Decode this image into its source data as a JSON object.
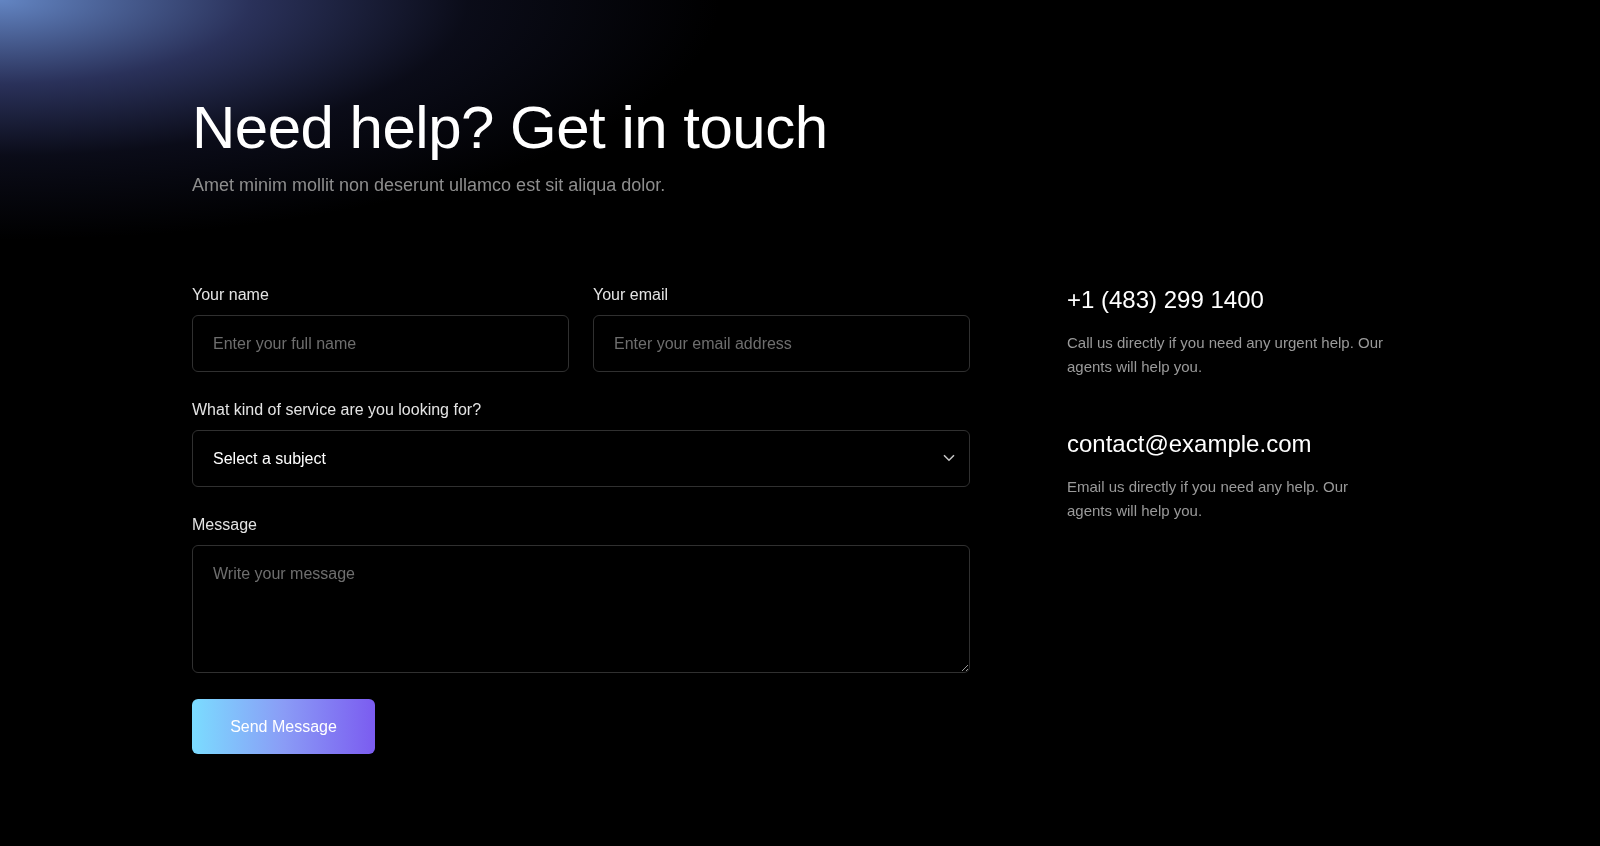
{
  "header": {
    "title": "Need help? Get in touch",
    "subtitle": "Amet minim mollit non deserunt ullamco est sit aliqua dolor."
  },
  "form": {
    "fields": [
      {
        "kind": "input",
        "label": "Your name",
        "placeholder": "Enter your full name"
      },
      {
        "kind": "input",
        "label": "Your email",
        "placeholder": "Enter your email address"
      },
      {
        "kind": "select",
        "label": "What kind of service are you looking for?",
        "value": "Select a subject"
      },
      {
        "kind": "textarea",
        "label": "Message",
        "placeholder": "Write your message"
      }
    ],
    "submit_button": "Send Message"
  },
  "contacts": [
    {
      "title": "+1 (483) 299 1400",
      "description": "Call us directly if you need any urgent help. Our agents will help you."
    },
    {
      "title": "contact@example.com",
      "description": "Email us directly if you need any help. Our agents will help you."
    }
  ]
}
